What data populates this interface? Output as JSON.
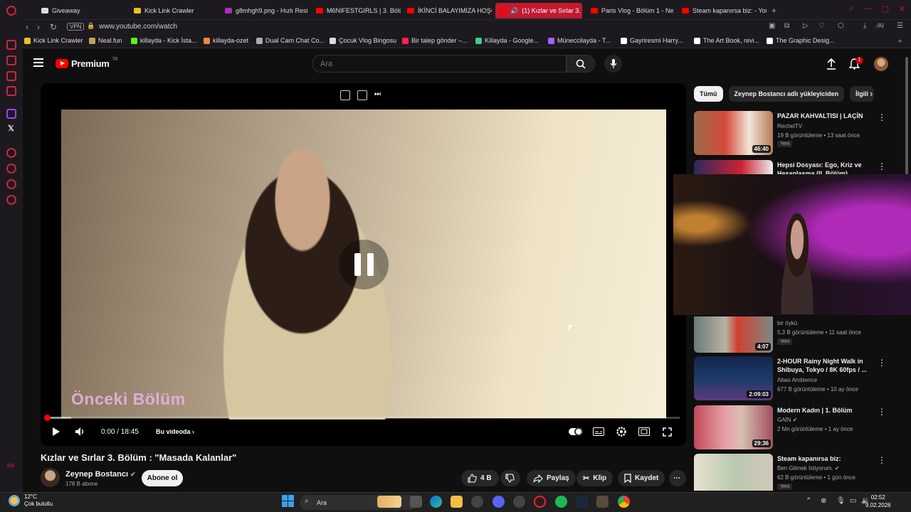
{
  "browser": {
    "tabs": [
      {
        "label": "Giveaway",
        "color": "#dddddd"
      },
      {
        "label": "Kick Link Crawler",
        "color": "#e8c21e"
      },
      {
        "label": "g8mhgh9.png - Hızlı Resi",
        "color": "#b02ab8"
      },
      {
        "label": "M6NIFESTGIRLS | 3. Bölü",
        "color": "#ff0000"
      },
      {
        "label": "İKİNCİ BALAYIMIZA HOŞG",
        "color": "#ff0000"
      },
      {
        "label": "(1) Kızlar ve Sırlar 3. B",
        "color": "#ffffff"
      },
      {
        "label": "Paris Vlog - Bölüm 1 - Ne",
        "color": "#ff0000"
      },
      {
        "label": "Steam kapanırsa biz: - You",
        "color": "#ff0000"
      }
    ],
    "new_tab": "+",
    "vpn": "VPN",
    "url": "www.youtube.com/watch",
    "bookmarks": [
      "Kick Link Crawler",
      "Neal.fun",
      "killayda - Kick İsta...",
      "killayda-ozet",
      "Dual Cam Chat Co...",
      "Çocuk Vlog Bingosu",
      "Bir talep gönder –...",
      "Killayda - Google...",
      "Müneccilayda - T...",
      "Gayriresmi Harry...",
      "The Art Book, revi...",
      "The Graphic Desig..."
    ]
  },
  "header": {
    "brand": "Premium",
    "region": "TR",
    "search_placeholder": "Ara",
    "notif_count": "1"
  },
  "player": {
    "overlay_text": "Önceki Bölüm",
    "time": "0:00 / 18:45",
    "chapter": "Bu videoda",
    "progress": 0.004
  },
  "video": {
    "title": "Kızlar ve Sırlar 3. Bölüm : \"Masada Kalanlar\"",
    "channel": "Zeynep Bostancı",
    "subscribers": "178 B abone",
    "subscribe_label": "Abone ol",
    "likes": "4 B",
    "share_label": "Paylaş",
    "clip_label": "Klip",
    "save_label": "Kaydet"
  },
  "chips": [
    "Tümü",
    "Zeynep Bostancı adlı yükleyiciden",
    "İlgili"
  ],
  "recommendations": [
    {
      "title": "PAZAR KAHVALTISI | LAÇİN",
      "channel": "RechelTV",
      "meta": "19 B görüntüleme • 13 saat önce",
      "badge": "Yeni",
      "duration": "46:40"
    },
    {
      "title": "Hepsi Dosyası: Ego, Kriz ve Hesaplaşma (II. Bölüm)",
      "channel": "",
      "meta": "",
      "badge": "",
      "duration": ""
    },
    {
      "title": "",
      "channel": "bir öykü",
      "meta": "5,3 B görüntüleme • 11 saat önce",
      "badge": "Yeni",
      "duration": "4:07"
    },
    {
      "title": "2-HOUR Rainy Night Walk in Shibuya, Tokyo / 8K 60fps / ...",
      "channel": "Abao Ambience",
      "meta": "677 B görüntüleme • 10 ay önce",
      "badge": "",
      "duration": "2:09:03"
    },
    {
      "title": "Modern Kadın | 1. Bölüm",
      "channel": "GAİN",
      "meta": "2 Mn görüntüleme • 1 ay önce",
      "badge": "",
      "duration": "29:36"
    },
    {
      "title": "Steam kapanırsa biz:",
      "channel": "Ben Gitmek İstiyorum.",
      "meta": "62 B görüntüleme • 1 gün önce",
      "badge": "Yeni",
      "duration": ""
    }
  ],
  "taskbar": {
    "temp": "12°C",
    "weather": "Çok bulutlu",
    "search": "Ara",
    "time": "02:52",
    "date": "9.02.2026"
  }
}
